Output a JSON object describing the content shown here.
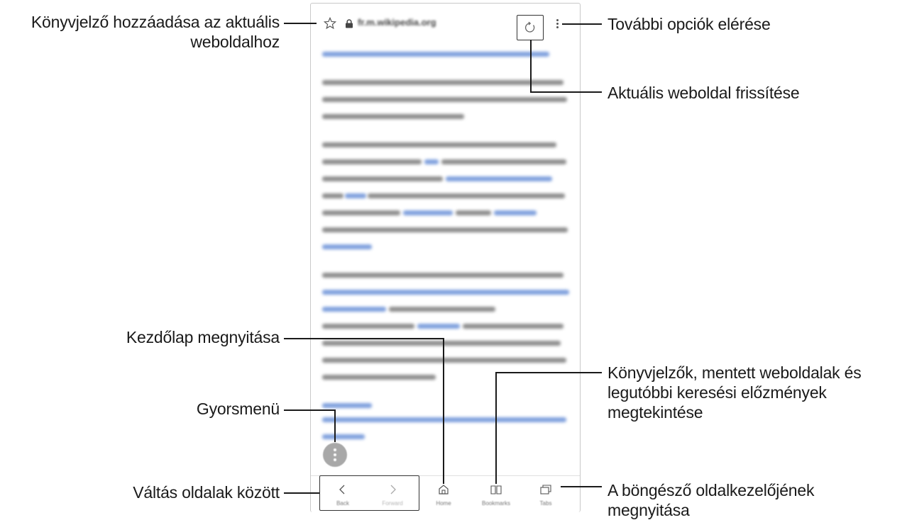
{
  "browser": {
    "url": "fr.m.wikipedia.org",
    "nav": [
      {
        "label": "Back",
        "icon": "chevron-left-icon"
      },
      {
        "label": "Forward",
        "icon": "chevron-right-icon"
      },
      {
        "label": "Home",
        "icon": "home-icon"
      },
      {
        "label": "Bookmarks",
        "icon": "bookmarks-icon"
      },
      {
        "label": "Tabs",
        "icon": "tabs-icon"
      }
    ]
  },
  "callouts": {
    "bookmark_add": [
      "Könyvjelző hozzáadása az aktuális",
      "weboldalhoz"
    ],
    "more_options": "További opciók elérése",
    "refresh": "Aktuális weboldal frissítése",
    "home": "Kezdőlap megnyitása",
    "quick_menu": "Gyorsmenü",
    "bookmarks": [
      "Könyvjelzők, mentett weboldalak és",
      "legutóbbi keresési előzmények",
      "megtekintése"
    ],
    "switch_pages": "Váltás oldalak között",
    "tab_manager": [
      "A böngésző oldalkezelőjének",
      "megnyitása"
    ]
  },
  "colors": {
    "text": "#1a1a1a",
    "link_blur": "#7fa0dd",
    "text_blur": "#8d8d8d",
    "fab": "#a8a8a8"
  }
}
